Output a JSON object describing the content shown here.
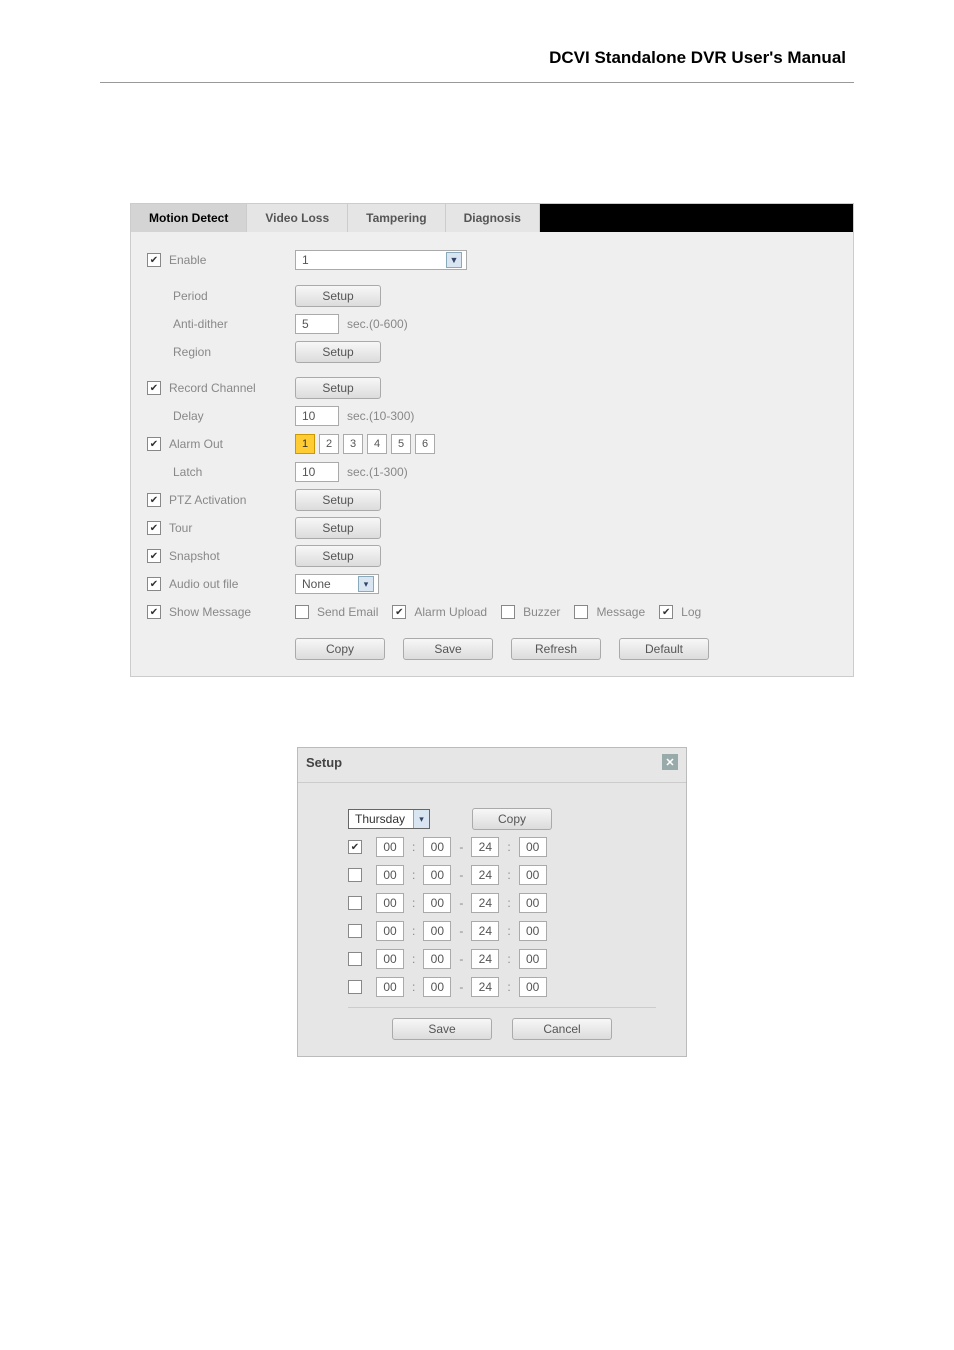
{
  "header": {
    "title": "DCVI Standalone DVR User's Manual"
  },
  "tabs": [
    "Motion Detect",
    "Video Loss",
    "Tampering",
    "Diagnosis"
  ],
  "active_tab_index": 0,
  "motion": {
    "enable_label": "Enable",
    "enable_value": "1",
    "period_label": "Period",
    "setup_btn": "Setup",
    "antidither_label": "Anti-dither",
    "antidither_value": "5",
    "antidither_unit": "sec.(0-600)",
    "region_label": "Region",
    "record_channel_label": "Record Channel",
    "delay_label": "Delay",
    "delay_value": "10",
    "delay_unit": "sec.(10-300)",
    "alarm_out_label": "Alarm Out",
    "alarm_out_channels": [
      "1",
      "2",
      "3",
      "4",
      "5",
      "6"
    ],
    "alarm_out_selected": [
      true,
      false,
      false,
      false,
      false,
      false
    ],
    "latch_label": "Latch",
    "latch_value": "10",
    "latch_unit": "sec.(1-300)",
    "ptz_label": "PTZ Activation",
    "tour_label": "Tour",
    "snapshot_label": "Snapshot",
    "audio_out_label": "Audio out file",
    "audio_out_value": "None",
    "show_message_label": "Show Message",
    "send_email_label": "Send Email",
    "alarm_upload_label": "Alarm Upload",
    "buzzer_label": "Buzzer",
    "message_label": "Message",
    "log_label": "Log",
    "copy_btn": "Copy",
    "save_btn": "Save",
    "refresh_btn": "Refresh",
    "default_btn": "Default"
  },
  "setup": {
    "title": "Setup",
    "day": "Thursday",
    "copy_btn": "Copy",
    "periods": [
      {
        "enabled": true,
        "sh": "00",
        "sm": "00",
        "eh": "24",
        "em": "00"
      },
      {
        "enabled": false,
        "sh": "00",
        "sm": "00",
        "eh": "24",
        "em": "00"
      },
      {
        "enabled": false,
        "sh": "00",
        "sm": "00",
        "eh": "24",
        "em": "00"
      },
      {
        "enabled": false,
        "sh": "00",
        "sm": "00",
        "eh": "24",
        "em": "00"
      },
      {
        "enabled": false,
        "sh": "00",
        "sm": "00",
        "eh": "24",
        "em": "00"
      },
      {
        "enabled": false,
        "sh": "00",
        "sm": "00",
        "eh": "24",
        "em": "00"
      }
    ],
    "save_btn": "Save",
    "cancel_btn": "Cancel"
  }
}
